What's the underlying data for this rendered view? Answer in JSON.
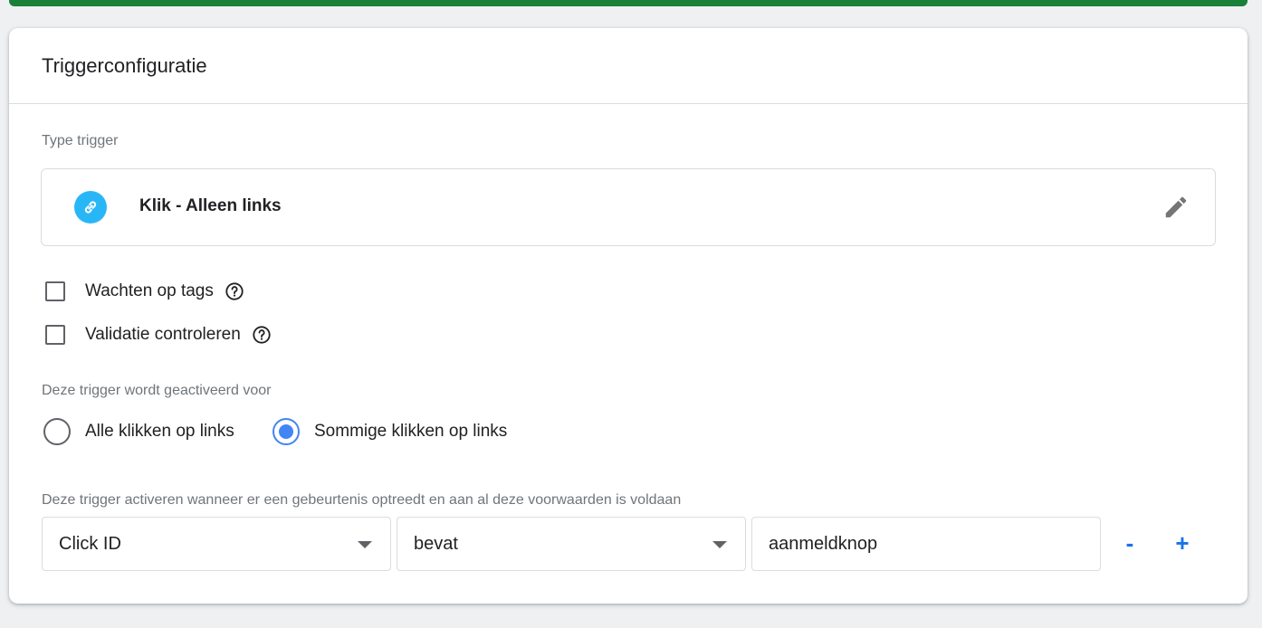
{
  "card": {
    "title": "Triggerconfiguratie",
    "type_label": "Type trigger",
    "trigger_type": {
      "name": "Klik - Alleen links",
      "icon": "link-icon",
      "icon_color": "#29b6f6"
    },
    "options": [
      {
        "label": "Wachten op tags",
        "checked": false
      },
      {
        "label": "Validatie controleren",
        "checked": false
      }
    ],
    "fires_label": "Deze trigger wordt geactiveerd voor",
    "radios": [
      {
        "label": "Alle klikken op links",
        "selected": false
      },
      {
        "label": "Sommige klikken op links",
        "selected": true
      }
    ],
    "conditions_label": "Deze trigger activeren wanneer er een gebeurtenis optreedt en aan al deze voorwaarden is voldaan",
    "condition": {
      "variable": "Click ID",
      "operator": "bevat",
      "value": "aanmeldknop"
    },
    "remove_label": "-",
    "add_label": "+"
  },
  "colors": {
    "accent": "#1a73e8",
    "radio": "#4285f4",
    "top_bar": "#188038"
  }
}
